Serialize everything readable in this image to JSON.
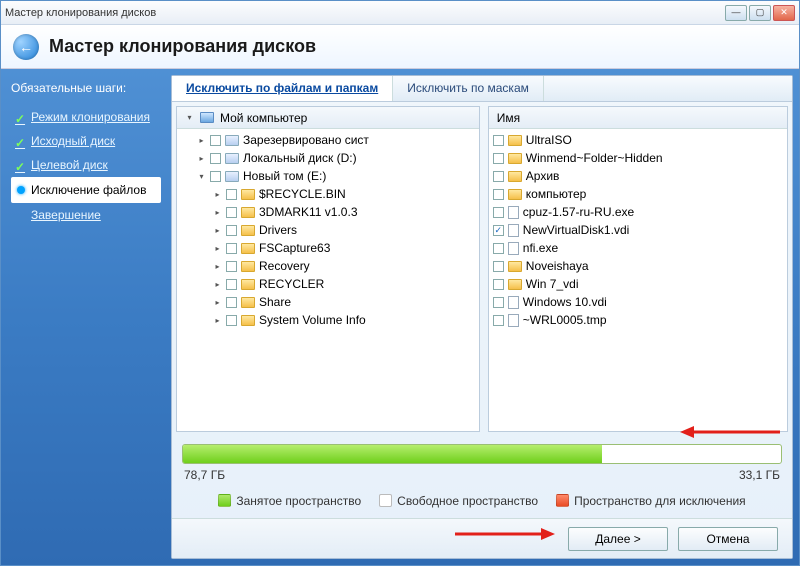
{
  "window": {
    "title": "Мастер клонирования дисков"
  },
  "header": {
    "title": "Мастер клонирования дисков"
  },
  "sidebar": {
    "heading": "Обязательные шаги:",
    "items": [
      {
        "label": "Режим клонирования",
        "done": true
      },
      {
        "label": "Исходный диск",
        "done": true
      },
      {
        "label": "Целевой диск",
        "done": true
      },
      {
        "label": "Исключение файлов",
        "current": true
      },
      {
        "label": "Завершение",
        "done": false
      }
    ]
  },
  "tabs": {
    "left": "Исключить по файлам и папкам",
    "right": "Исключить по маскам"
  },
  "tree": {
    "header": "Мой компьютер",
    "rows": [
      {
        "indent": 1,
        "exp": "▸",
        "label": "Зарезервировано сист",
        "icon": "drive",
        "checked": false
      },
      {
        "indent": 1,
        "exp": "▸",
        "label": "Локальный диск (D:)",
        "icon": "drive",
        "checked": false
      },
      {
        "indent": 1,
        "exp": "▾",
        "label": "Новый том (E:)",
        "icon": "drive",
        "checked": false
      },
      {
        "indent": 2,
        "exp": "▸",
        "label": "$RECYCLE.BIN",
        "icon": "folder",
        "checked": false
      },
      {
        "indent": 2,
        "exp": "▸",
        "label": "3DMARK11 v1.0.3",
        "icon": "folder",
        "checked": false
      },
      {
        "indent": 2,
        "exp": "▸",
        "label": "Drivers",
        "icon": "folder",
        "checked": false
      },
      {
        "indent": 2,
        "exp": "▸",
        "label": "FSCapture63",
        "icon": "folder",
        "checked": false
      },
      {
        "indent": 2,
        "exp": "▸",
        "label": "Recovery",
        "icon": "folder",
        "checked": false
      },
      {
        "indent": 2,
        "exp": "▸",
        "label": "RECYCLER",
        "icon": "folder",
        "checked": false
      },
      {
        "indent": 2,
        "exp": "▸",
        "label": "Share",
        "icon": "folder",
        "checked": false
      },
      {
        "indent": 2,
        "exp": "▸",
        "label": "System Volume Info",
        "icon": "folder",
        "checked": false
      }
    ]
  },
  "list": {
    "header": "Имя",
    "rows": [
      {
        "label": "UltraISO",
        "icon": "folder",
        "checked": false
      },
      {
        "label": "Winmend~Folder~Hidden",
        "icon": "folder",
        "checked": false
      },
      {
        "label": "Архив",
        "icon": "folder",
        "checked": false
      },
      {
        "label": "компьютер",
        "icon": "folder",
        "checked": false
      },
      {
        "label": "cpuz-1.57-ru-RU.exe",
        "icon": "file",
        "checked": false
      },
      {
        "label": "NewVirtualDisk1.vdi",
        "icon": "file",
        "checked": true
      },
      {
        "label": "nfi.exe",
        "icon": "file",
        "checked": false
      },
      {
        "label": "Noveishaya",
        "icon": "folder",
        "checked": false
      },
      {
        "label": "Win 7_vdi",
        "icon": "folder",
        "checked": false
      },
      {
        "label": "Windows 10.vdi",
        "icon": "file",
        "checked": false
      },
      {
        "label": "~WRL0005.tmp",
        "icon": "file",
        "checked": false
      }
    ]
  },
  "usage": {
    "used_label": "78,7 ГБ",
    "free_label": "33,1 ГБ",
    "fill_percent": 70
  },
  "legend": {
    "used": "Занятое пространство",
    "free": "Свободное пространство",
    "excl": "Пространство для исключения"
  },
  "footer": {
    "next": "Далее >",
    "cancel": "Отмена"
  }
}
